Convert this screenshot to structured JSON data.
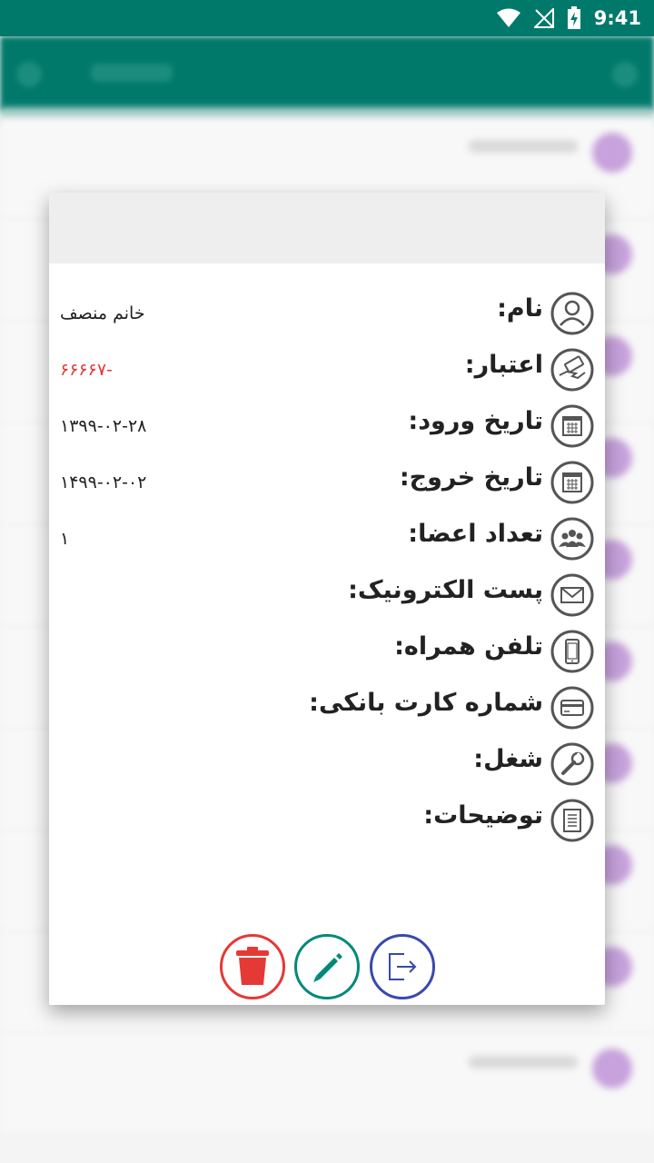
{
  "status_bar": {
    "time": "9:41",
    "icons": [
      "wifi-icon",
      "no-signal-icon",
      "battery-charging-icon"
    ]
  },
  "colors": {
    "primary": "#00796b",
    "danger": "#e53935",
    "edit": "#00897b",
    "exit": "#3949ab",
    "icon_gray": "#555555"
  },
  "dialog": {
    "fields": [
      {
        "label": "نام:",
        "value": "خانم منصف",
        "icon": "user-icon"
      },
      {
        "label": "اعتبار:",
        "value": "-۶۶۶۶۷",
        "icon": "money-hand-icon"
      },
      {
        "label": "تاریخ ورود:",
        "value": "۱۳۹۹-۰۲-۲۸",
        "icon": "calendar-icon"
      },
      {
        "label": "تاریخ خروج:",
        "value": "۱۴۹۹-۰۲-۰۲",
        "icon": "calendar-icon"
      },
      {
        "label": "تعداد اعضا:",
        "value": "۱",
        "icon": "group-icon"
      },
      {
        "label": "پست الکترونیک:",
        "value": "",
        "icon": "mail-icon"
      },
      {
        "label": "تلفن همراه:",
        "value": "",
        "icon": "mobile-icon"
      },
      {
        "label": "شماره کارت بانکی:",
        "value": "",
        "icon": "card-icon"
      },
      {
        "label": "شغل:",
        "value": "",
        "icon": "tools-icon"
      },
      {
        "label": "توضیحات:",
        "value": "",
        "icon": "notes-icon"
      }
    ],
    "actions": [
      {
        "name": "delete",
        "icon": "trash-icon"
      },
      {
        "name": "edit",
        "icon": "pencil-icon"
      },
      {
        "name": "exit",
        "icon": "exit-icon"
      }
    ]
  }
}
